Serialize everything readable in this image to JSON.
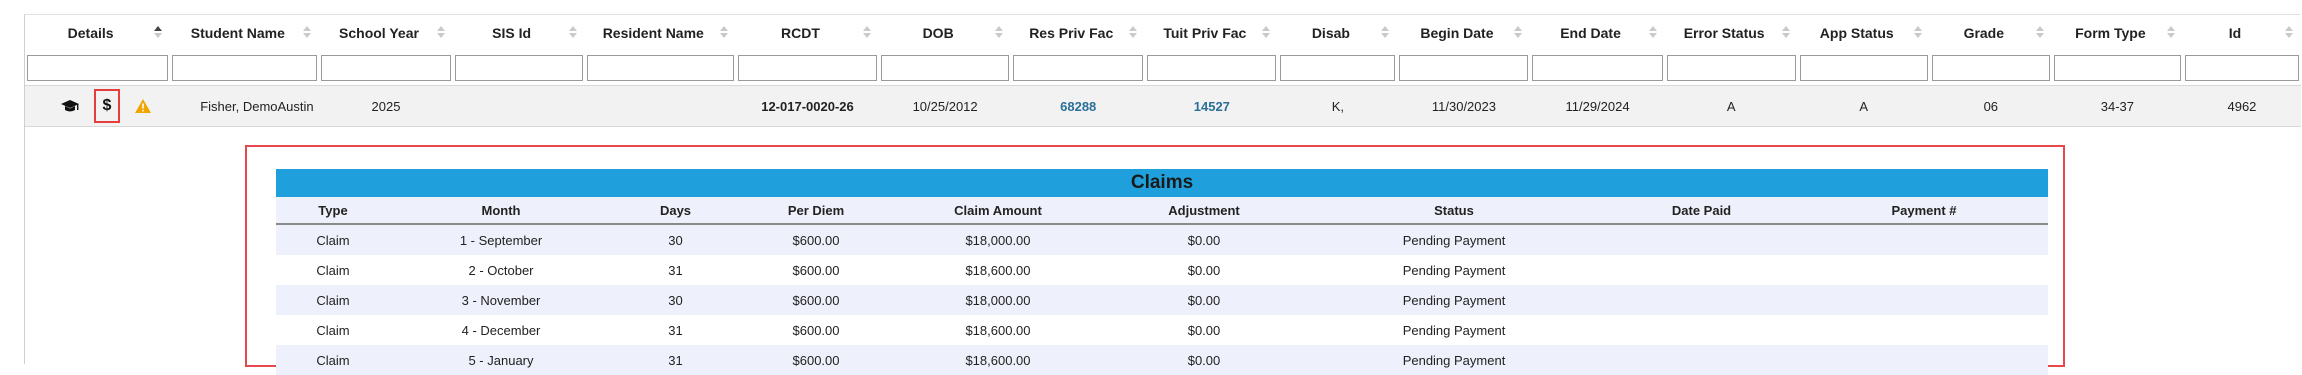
{
  "grid": {
    "columns": [
      "Details",
      "Student Name",
      "School Year",
      "SIS Id",
      "Resident Name",
      "RCDT",
      "DOB",
      "Res Priv Fac",
      "Tuit Priv Fac",
      "Disab",
      "Begin Date",
      "End Date",
      "Error Status",
      "App Status",
      "Grade",
      "Form Type",
      "Id"
    ],
    "row": {
      "student_name": "Fisher, DemoAustin",
      "school_year": "2025",
      "sis_id": "",
      "resident_name": "",
      "rcdt": "12-017-0020-26",
      "dob": "10/25/2012",
      "res_priv_fac": "68288",
      "tuit_priv_fac": "14527",
      "disab": "K,",
      "begin_date": "11/30/2023",
      "end_date": "11/29/2024",
      "error_status": "A",
      "app_status": "A",
      "grade": "06",
      "form_type": "34-37",
      "id": "4962"
    },
    "details_icons": [
      "graduation-cap-icon",
      "dollar-icon",
      "warning-icon"
    ],
    "dollar_label": "$"
  },
  "claims": {
    "title": "Claims",
    "columns": [
      "Type",
      "Month",
      "Days",
      "Per Diem",
      "Claim Amount",
      "Adjustment",
      "Status",
      "Date Paid",
      "Payment #"
    ],
    "rows": [
      [
        "Claim",
        "1 - September",
        "30",
        "$600.00",
        "$18,000.00",
        "$0.00",
        "Pending Payment",
        "",
        ""
      ],
      [
        "Claim",
        "2 - October",
        "31",
        "$600.00",
        "$18,600.00",
        "$0.00",
        "Pending Payment",
        "",
        ""
      ],
      [
        "Claim",
        "3 - November",
        "30",
        "$600.00",
        "$18,000.00",
        "$0.00",
        "Pending Payment",
        "",
        ""
      ],
      [
        "Claim",
        "4 - December",
        "31",
        "$600.00",
        "$18,600.00",
        "$0.00",
        "Pending Payment",
        "",
        ""
      ],
      [
        "Claim",
        "5 - January",
        "31",
        "$600.00",
        "$18,600.00",
        "$0.00",
        "Pending Payment",
        "",
        ""
      ]
    ]
  },
  "colors": {
    "header_bar": "#1fa0dc",
    "highlight_border": "#e5484d",
    "link": "#2a6f97",
    "row_band": "#eef1fb"
  }
}
